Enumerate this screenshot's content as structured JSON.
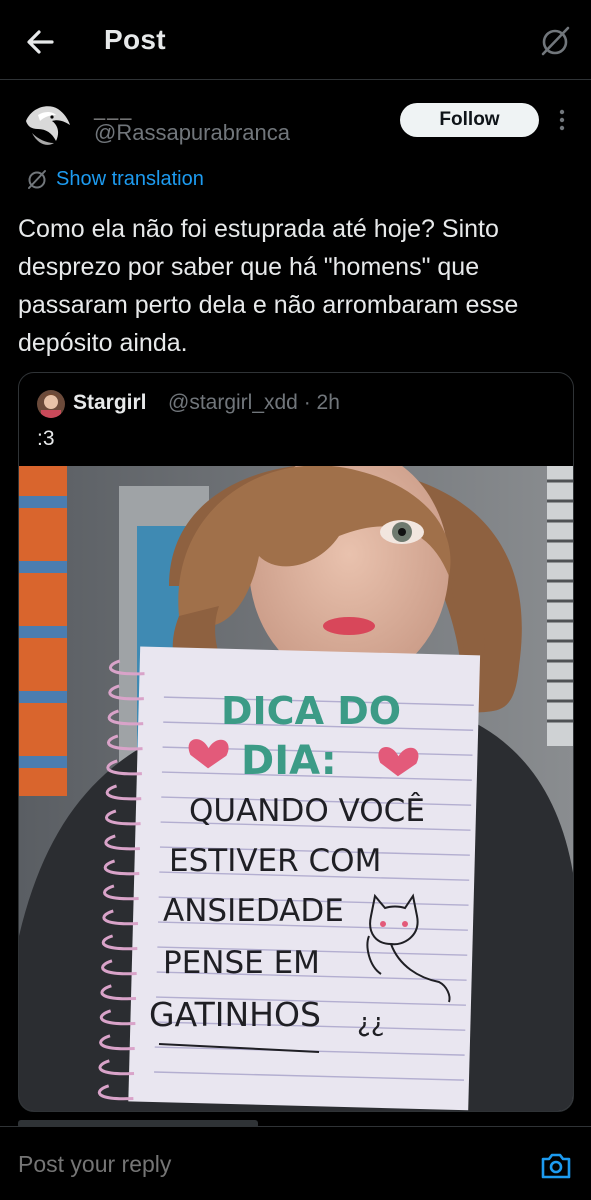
{
  "header": {
    "title": "Post",
    "back_icon": "arrow-left-icon",
    "translate_icon": "translate-off-icon"
  },
  "author": {
    "display_name": "___",
    "handle": "@Rassapurabranca",
    "follow_label": "Follow"
  },
  "show_translation": "Show translation",
  "post_text": "Como ela não foi estuprada até hoje? Sinto desprezo por saber que há \"homens\" que passaram perto dela e não arrombaram esse depósito ainda.",
  "quote": {
    "name": "Stargirl",
    "meta": "@stargirl_xdd · 2h",
    "text": ":3",
    "notebook": {
      "line1": "DICA DO",
      "line2": "DIA:",
      "line3": "QUANDO VOCÊ",
      "line4": "ESTIVER COM",
      "line5": "ANSIEDADE",
      "line6": "PENSE EM",
      "line7": "GATINHOS",
      "emoticon": "¿̮¿"
    }
  },
  "reply": {
    "placeholder": "Post your reply",
    "camera_icon": "camera-icon"
  },
  "colors": {
    "background": "#000000",
    "accent": "#1d9bf0",
    "text_primary": "#e7e9ea",
    "text_secondary": "#71767b",
    "border": "#2f3336"
  }
}
